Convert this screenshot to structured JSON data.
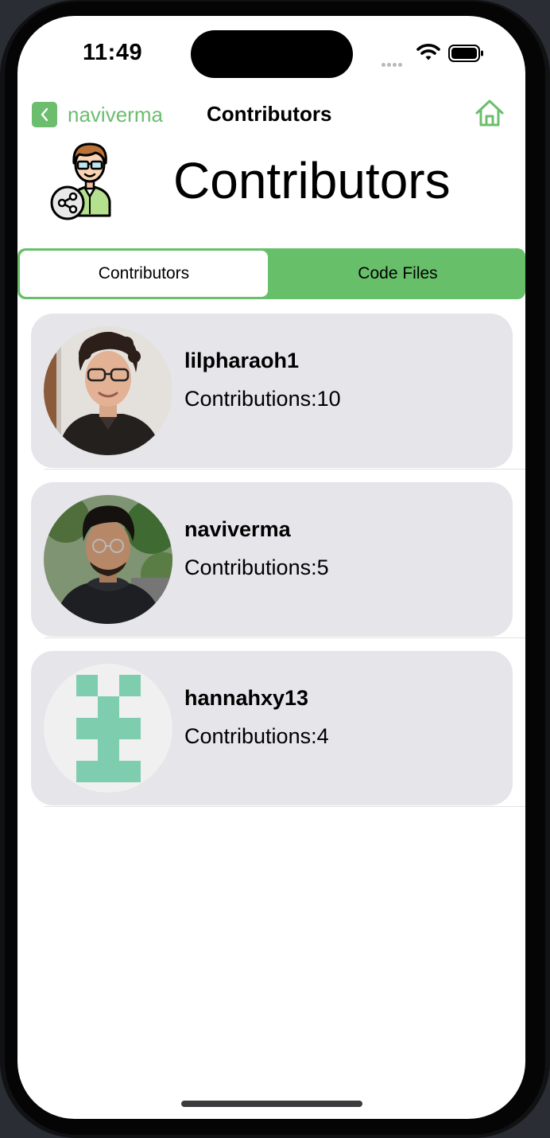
{
  "status_bar": {
    "time": "11:49"
  },
  "nav": {
    "back_label": "naviverma",
    "title": "Contributors"
  },
  "header": {
    "title": "Contributors"
  },
  "tabs": [
    {
      "label": "Contributors",
      "selected": true
    },
    {
      "label": "Code Files",
      "selected": false
    }
  ],
  "contributors": [
    {
      "username": "lilpharaoh1",
      "contributions": "Contributions:10"
    },
    {
      "username": "naviverma",
      "contributions": "Contributions:5"
    },
    {
      "username": "hannahxy13",
      "contributions": "Contributions:4"
    }
  ],
  "colors": {
    "accent": "#6cbe6e",
    "card": "#e5e5ea",
    "identicon": "#7fcdaf"
  },
  "icons": [
    "chevron-left-icon",
    "house-icon",
    "contributor-share-icon",
    "wifi-icon",
    "battery-icon"
  ]
}
